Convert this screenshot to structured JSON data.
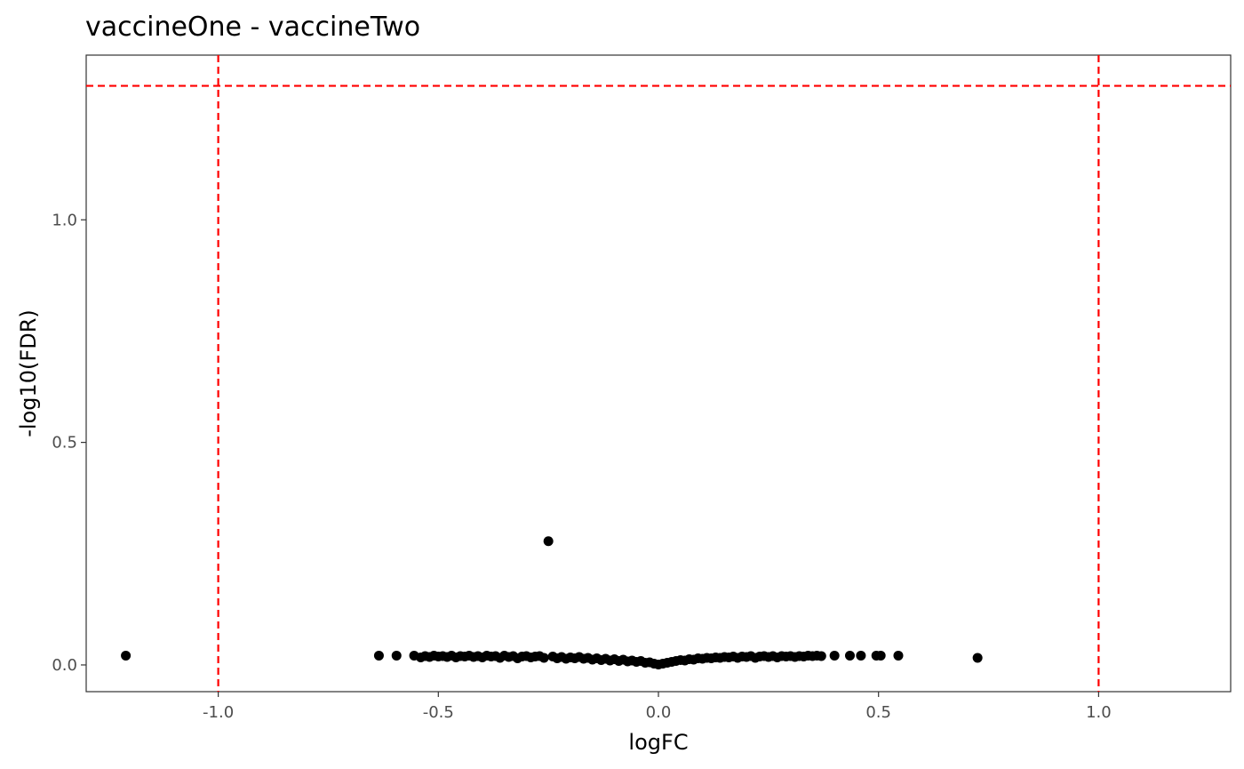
{
  "chart_data": {
    "type": "scatter",
    "title": "vaccineOne - vaccineTwo",
    "xlabel": "logFC",
    "ylabel": "-log10(FDR)",
    "xlim": [
      -1.3,
      1.3
    ],
    "ylim": [
      -0.06,
      1.37
    ],
    "x_ticks": [
      -1.0,
      -0.5,
      0.0,
      0.5,
      1.0
    ],
    "x_tick_labels": [
      "-1.0",
      "-0.5",
      "0.0",
      "0.5",
      "1.0"
    ],
    "y_ticks": [
      0.0,
      0.5,
      1.0
    ],
    "y_tick_labels": [
      "0.0",
      "0.5",
      "1.0"
    ],
    "grid": false,
    "reference_lines": {
      "color": "#ff0000",
      "style": "dashed",
      "vertical_x": [
        -1.0,
        1.0
      ],
      "horizontal_y": [
        1.301
      ]
    },
    "point_color": "#000000",
    "points": [
      [
        -1.21,
        0.021
      ],
      [
        -0.25,
        0.278
      ],
      [
        -0.635,
        0.021
      ],
      [
        -0.595,
        0.021
      ],
      [
        -0.555,
        0.021
      ],
      [
        -0.54,
        0.017
      ],
      [
        -0.53,
        0.02
      ],
      [
        -0.52,
        0.018
      ],
      [
        -0.51,
        0.021
      ],
      [
        -0.5,
        0.019
      ],
      [
        -0.49,
        0.02
      ],
      [
        -0.48,
        0.018
      ],
      [
        -0.47,
        0.021
      ],
      [
        -0.46,
        0.017
      ],
      [
        -0.45,
        0.02
      ],
      [
        -0.44,
        0.019
      ],
      [
        -0.43,
        0.021
      ],
      [
        -0.42,
        0.018
      ],
      [
        -0.41,
        0.02
      ],
      [
        -0.4,
        0.017
      ],
      [
        -0.39,
        0.021
      ],
      [
        -0.38,
        0.019
      ],
      [
        -0.37,
        0.02
      ],
      [
        -0.36,
        0.016
      ],
      [
        -0.35,
        0.021
      ],
      [
        -0.34,
        0.018
      ],
      [
        -0.33,
        0.02
      ],
      [
        -0.32,
        0.015
      ],
      [
        -0.31,
        0.019
      ],
      [
        -0.3,
        0.02
      ],
      [
        -0.29,
        0.017
      ],
      [
        -0.28,
        0.019
      ],
      [
        -0.27,
        0.02
      ],
      [
        -0.26,
        0.016
      ],
      [
        -0.24,
        0.019
      ],
      [
        -0.23,
        0.015
      ],
      [
        -0.22,
        0.018
      ],
      [
        -0.21,
        0.014
      ],
      [
        -0.2,
        0.017
      ],
      [
        -0.19,
        0.015
      ],
      [
        -0.18,
        0.018
      ],
      [
        -0.17,
        0.014
      ],
      [
        -0.16,
        0.016
      ],
      [
        -0.15,
        0.012
      ],
      [
        -0.14,
        0.015
      ],
      [
        -0.13,
        0.011
      ],
      [
        -0.12,
        0.014
      ],
      [
        -0.11,
        0.01
      ],
      [
        -0.1,
        0.013
      ],
      [
        -0.09,
        0.009
      ],
      [
        -0.08,
        0.012
      ],
      [
        -0.07,
        0.008
      ],
      [
        -0.06,
        0.01
      ],
      [
        -0.05,
        0.007
      ],
      [
        -0.04,
        0.009
      ],
      [
        -0.03,
        0.005
      ],
      [
        -0.02,
        0.006
      ],
      [
        -0.01,
        0.003
      ],
      [
        0.0,
        0.001
      ],
      [
        0.01,
        0.003
      ],
      [
        0.02,
        0.005
      ],
      [
        0.03,
        0.007
      ],
      [
        0.04,
        0.009
      ],
      [
        0.05,
        0.011
      ],
      [
        0.06,
        0.01
      ],
      [
        0.07,
        0.013
      ],
      [
        0.08,
        0.012
      ],
      [
        0.09,
        0.015
      ],
      [
        0.1,
        0.014
      ],
      [
        0.11,
        0.016
      ],
      [
        0.12,
        0.015
      ],
      [
        0.13,
        0.017
      ],
      [
        0.14,
        0.016
      ],
      [
        0.15,
        0.018
      ],
      [
        0.16,
        0.017
      ],
      [
        0.17,
        0.019
      ],
      [
        0.18,
        0.016
      ],
      [
        0.19,
        0.019
      ],
      [
        0.2,
        0.018
      ],
      [
        0.21,
        0.02
      ],
      [
        0.22,
        0.016
      ],
      [
        0.23,
        0.019
      ],
      [
        0.24,
        0.02
      ],
      [
        0.25,
        0.018
      ],
      [
        0.26,
        0.02
      ],
      [
        0.27,
        0.017
      ],
      [
        0.28,
        0.02
      ],
      [
        0.29,
        0.019
      ],
      [
        0.3,
        0.02
      ],
      [
        0.31,
        0.018
      ],
      [
        0.32,
        0.02
      ],
      [
        0.33,
        0.019
      ],
      [
        0.34,
        0.021
      ],
      [
        0.35,
        0.02
      ],
      [
        0.36,
        0.021
      ],
      [
        0.37,
        0.02
      ],
      [
        0.4,
        0.021
      ],
      [
        0.435,
        0.021
      ],
      [
        0.46,
        0.021
      ],
      [
        0.495,
        0.021
      ],
      [
        0.505,
        0.021
      ],
      [
        0.545,
        0.021
      ],
      [
        0.725,
        0.016
      ]
    ]
  }
}
